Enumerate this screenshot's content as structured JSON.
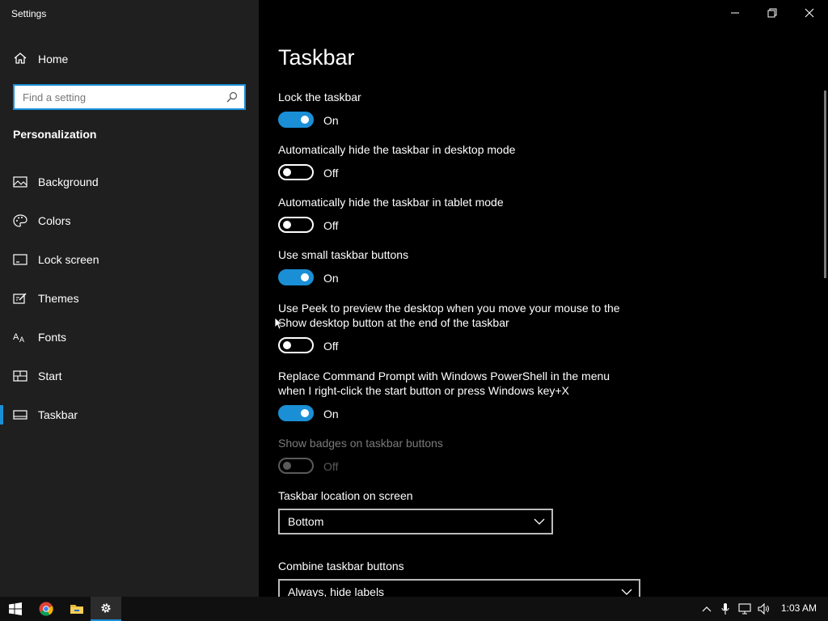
{
  "window": {
    "title": "Settings"
  },
  "sidebar": {
    "home_label": "Home",
    "search_placeholder": "Find a setting",
    "section_title": "Personalization",
    "items": [
      {
        "label": "Background",
        "icon": "background-icon"
      },
      {
        "label": "Colors",
        "icon": "palette-icon"
      },
      {
        "label": "Lock screen",
        "icon": "lock-screen-icon"
      },
      {
        "label": "Themes",
        "icon": "themes-icon"
      },
      {
        "label": "Fonts",
        "icon": "fonts-icon"
      },
      {
        "label": "Start",
        "icon": "start-icon"
      },
      {
        "label": "Taskbar",
        "icon": "taskbar-icon",
        "active": true
      }
    ]
  },
  "main": {
    "title": "Taskbar",
    "settings": [
      {
        "label": "Lock the taskbar",
        "state": "On",
        "on": true
      },
      {
        "label": "Automatically hide the taskbar in desktop mode",
        "state": "Off",
        "on": false
      },
      {
        "label": "Automatically hide the taskbar in tablet mode",
        "state": "Off",
        "on": false
      },
      {
        "label": "Use small taskbar buttons",
        "state": "On",
        "on": true
      },
      {
        "label": "Use Peek to preview the desktop when you move your mouse to the Show desktop button at the end of the taskbar",
        "state": "Off",
        "on": false
      },
      {
        "label": "Replace Command Prompt with Windows PowerShell in the menu when I right-click the start button or press Windows key+X",
        "state": "On",
        "on": true
      },
      {
        "label": "Show badges on taskbar buttons",
        "state": "Off",
        "on": false,
        "disabled": true
      }
    ],
    "location": {
      "label": "Taskbar location on screen",
      "value": "Bottom"
    },
    "combine": {
      "label": "Combine taskbar buttons",
      "value": "Always, hide labels"
    }
  },
  "taskbar": {
    "clock": "1:03 AM",
    "apps": [
      "windows-start-icon",
      "chrome-icon",
      "file-explorer-icon",
      "settings-gear-icon"
    ]
  },
  "colors": {
    "accent": "#1a8fd6",
    "sidebar_bg": "#1f1f1f",
    "content_bg": "#000000"
  }
}
